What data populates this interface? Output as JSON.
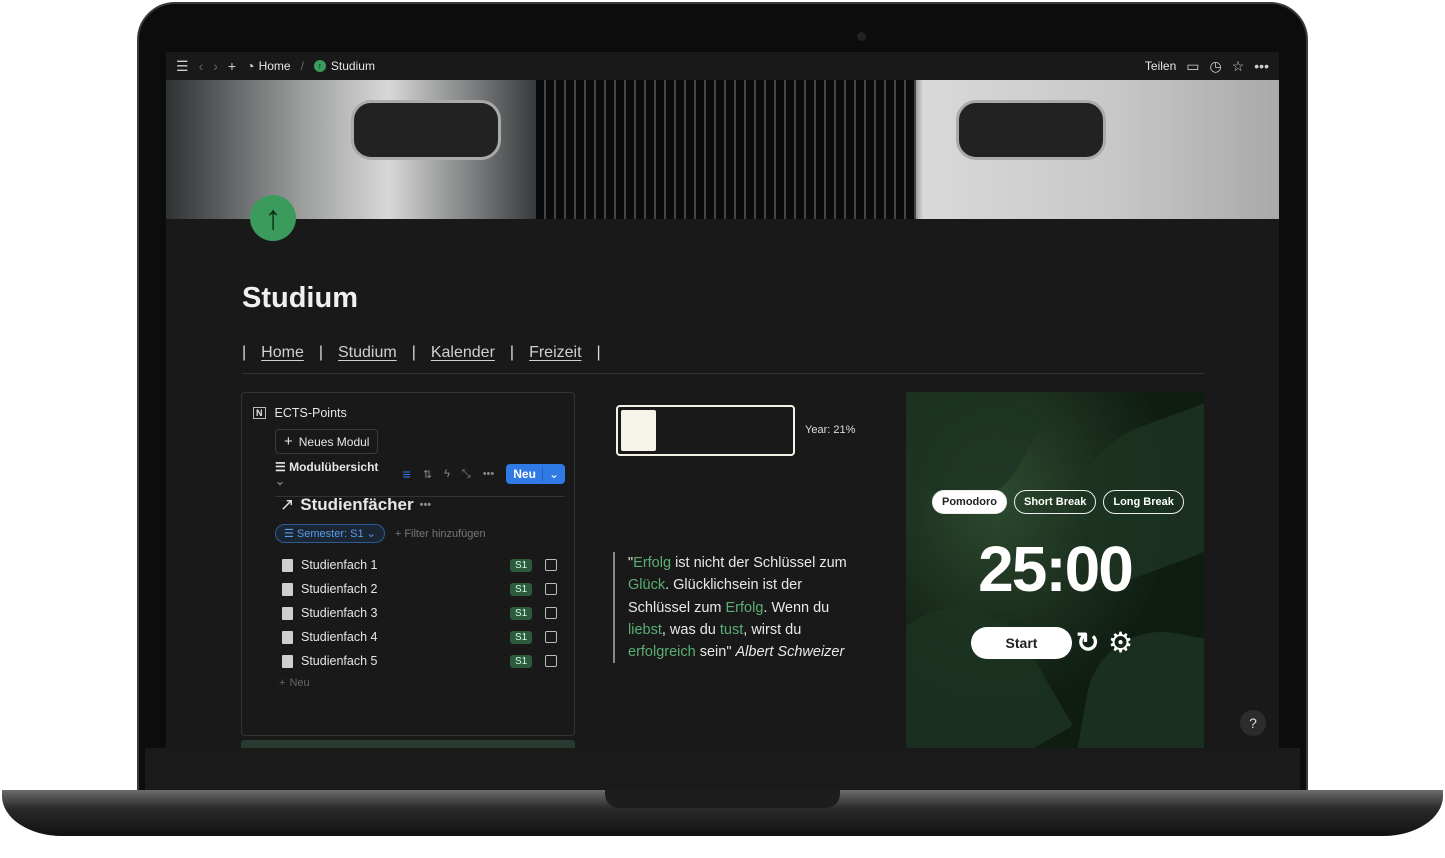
{
  "topbar": {
    "breadcrumb": [
      "Home",
      "Studium"
    ],
    "share": "Teilen"
  },
  "page": {
    "title": "Studium",
    "nav": [
      "Home",
      "Studium",
      "Kalender",
      "Freizeit"
    ]
  },
  "database": {
    "source": "ECTS-Points",
    "new_module": "Neues Modul",
    "view": "Modulübersicht",
    "new_button": "Neu",
    "heading": "Studienfächer",
    "filter": "Semester: S1",
    "add_filter": "Filter hinzufügen",
    "rows": [
      {
        "name": "Studienfach 1",
        "semester": "S1",
        "done": false
      },
      {
        "name": "Studienfach 2",
        "semester": "S1",
        "done": false
      },
      {
        "name": "Studienfach 3",
        "semester": "S1",
        "done": false
      },
      {
        "name": "Studienfach 4",
        "semester": "S1",
        "done": false
      },
      {
        "name": "Studienfach 5",
        "semester": "S1",
        "done": false
      }
    ],
    "add_row": "Neu"
  },
  "progress": {
    "label": "Year: 21%",
    "value": 0.21
  },
  "quote": {
    "parts": [
      "\"",
      "Erfolg",
      " ist nicht der Schlüssel zum ",
      "Glück",
      ". Glücklichsein ist der Schlüssel zum ",
      "Erfolg",
      ". Wenn du ",
      "liebst",
      ", was du ",
      "tust",
      ", wirst du ",
      "erfolgreich",
      " sein\" "
    ],
    "author": "Albert Schweizer"
  },
  "timer": {
    "modes": [
      "Pomodoro",
      "Short Break",
      "Long Break"
    ],
    "active_mode": "Pomodoro",
    "time": "25:00",
    "start": "Start"
  },
  "help": "?",
  "colors": {
    "accent": "#2f7ae5",
    "green": "#5aae73",
    "page_icon": "#3a9b5c"
  }
}
